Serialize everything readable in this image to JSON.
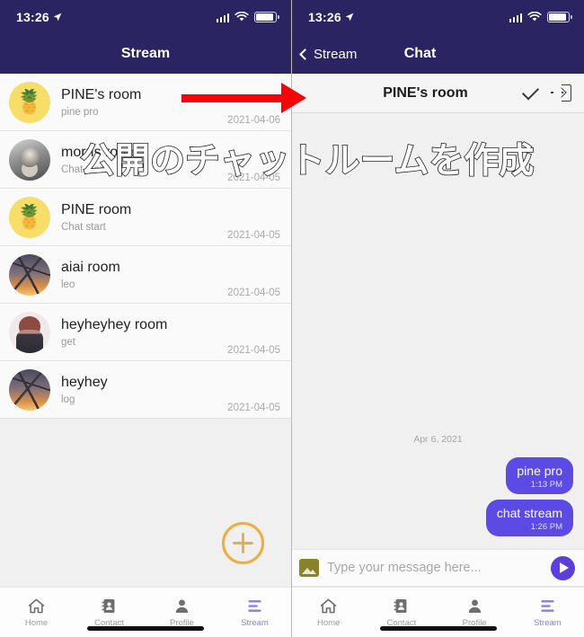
{
  "status_bar": {
    "time": "13:26",
    "location_icon": "location-arrow-icon",
    "signal_icon": "cellular-signal-icon",
    "wifi_icon": "wifi-icon",
    "battery_icon": "battery-full-icon"
  },
  "left_panel": {
    "nav_title": "Stream",
    "rooms": [
      {
        "name": "PINE's room",
        "subtitle": "pine pro",
        "date": "2021-04-06",
        "avatar": "pineapple-avatar"
      },
      {
        "name": "morris room",
        "subtitle": "Chat start",
        "date": "2021-04-05",
        "avatar": "portrait-avatar"
      },
      {
        "name": "PINE room",
        "subtitle": "Chat start",
        "date": "2021-04-05",
        "avatar": "pineapple-avatar"
      },
      {
        "name": "aiai room",
        "subtitle": "leo",
        "date": "2021-04-05",
        "avatar": "sakura-avatar"
      },
      {
        "name": "heyheyhey room",
        "subtitle": "get",
        "date": "2021-04-05",
        "avatar": "anime-avatar"
      },
      {
        "name": "heyhey",
        "subtitle": "log",
        "date": "2021-04-05",
        "avatar": "sakura-avatar"
      }
    ],
    "fab": {
      "icon": "plus-circle-icon",
      "color": "#eeae3d"
    }
  },
  "right_panel": {
    "nav_back_label": "Stream",
    "nav_title": "Chat",
    "room_header": {
      "title": "PINE's room",
      "confirm_icon": "check-icon",
      "leave_icon": "exit-room-icon"
    },
    "day_separator": "Apr 6, 2021",
    "messages": [
      {
        "text": "pine pro",
        "time": "1:13 PM",
        "side": "outgoing"
      },
      {
        "text": "chat stream",
        "time": "1:26 PM",
        "side": "outgoing"
      }
    ],
    "composer": {
      "image_icon": "image-attach-icon",
      "placeholder": "Type your message here...",
      "value": "",
      "send_icon": "send-icon"
    }
  },
  "tabbar": {
    "items": [
      {
        "label": "Home",
        "icon": "home-icon",
        "active": false
      },
      {
        "label": "Contact",
        "icon": "contacts-icon",
        "active": false
      },
      {
        "label": "Profile",
        "icon": "person-icon",
        "active": false
      },
      {
        "label": "Stream",
        "icon": "stream-icon",
        "active": true
      }
    ]
  },
  "annotations": {
    "arrow": "red-right-arrow",
    "caption": "公開のチャットルームを作成"
  },
  "colors": {
    "navbar": "#2b2463",
    "accent_purple": "#5b4ae4",
    "tab_active": "#8a7fe0",
    "fab_orange": "#eeae3d",
    "annotation_red": "#fb0007"
  }
}
